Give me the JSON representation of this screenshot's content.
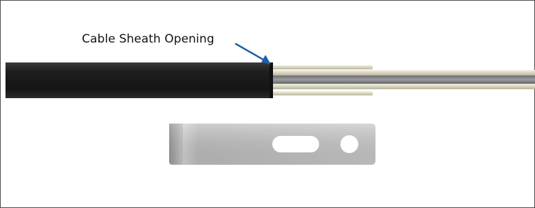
{
  "diagram": {
    "callout": {
      "label": "Cable Sheath Opening",
      "arrow_color": "#1d5fa8"
    },
    "colors": {
      "sheath": "#1b1b1b",
      "fiber_core": "#8a8a8a",
      "strength_member": "#d9d6c2",
      "clip": "#b8b8b8",
      "border": "#4a4a4a"
    }
  }
}
